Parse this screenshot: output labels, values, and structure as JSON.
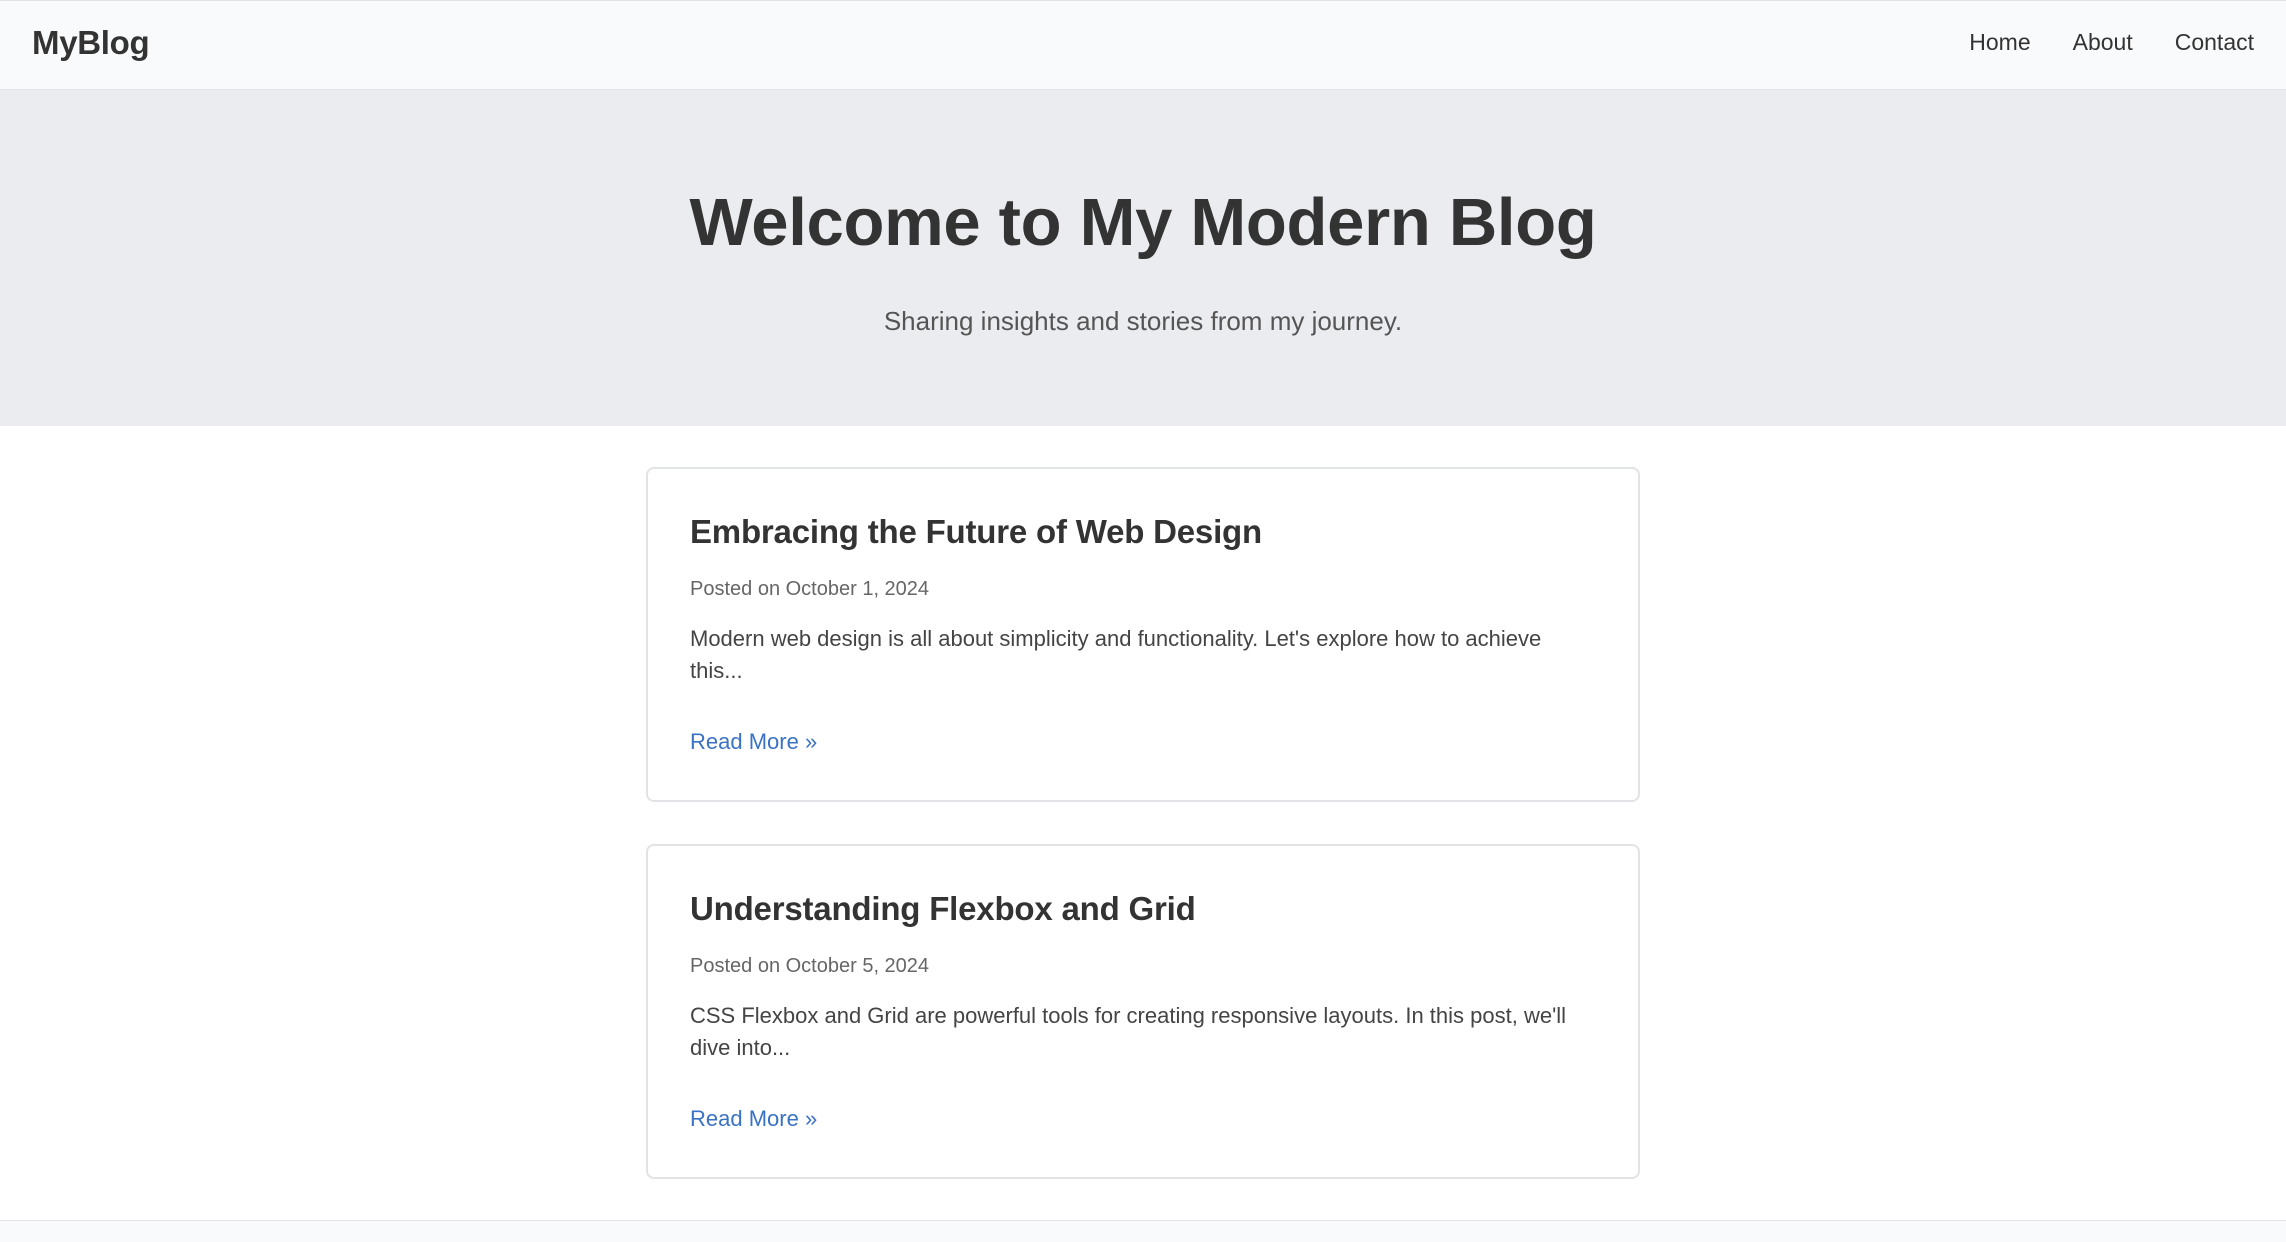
{
  "header": {
    "brand": "MyBlog",
    "nav": [
      "Home",
      "About",
      "Contact"
    ]
  },
  "hero": {
    "title": "Welcome to My Modern Blog",
    "subtitle": "Sharing insights and stories from my journey."
  },
  "posts": [
    {
      "title": "Embracing the Future of Web Design",
      "date": "Posted on October 1, 2024",
      "excerpt": "Modern web design is all about simplicity and functionality. Let's explore how to achieve this...",
      "link": "Read More »"
    },
    {
      "title": "Understanding Flexbox and Grid",
      "date": "Posted on October 5, 2024",
      "excerpt": "CSS Flexbox and Grid are powerful tools for creating responsive layouts. In this post, we'll dive into...",
      "link": "Read More »"
    }
  ],
  "colors": {
    "link": "#3a72c4",
    "hero_bg": "#ebecef",
    "header_bg": "#f9fafb"
  }
}
